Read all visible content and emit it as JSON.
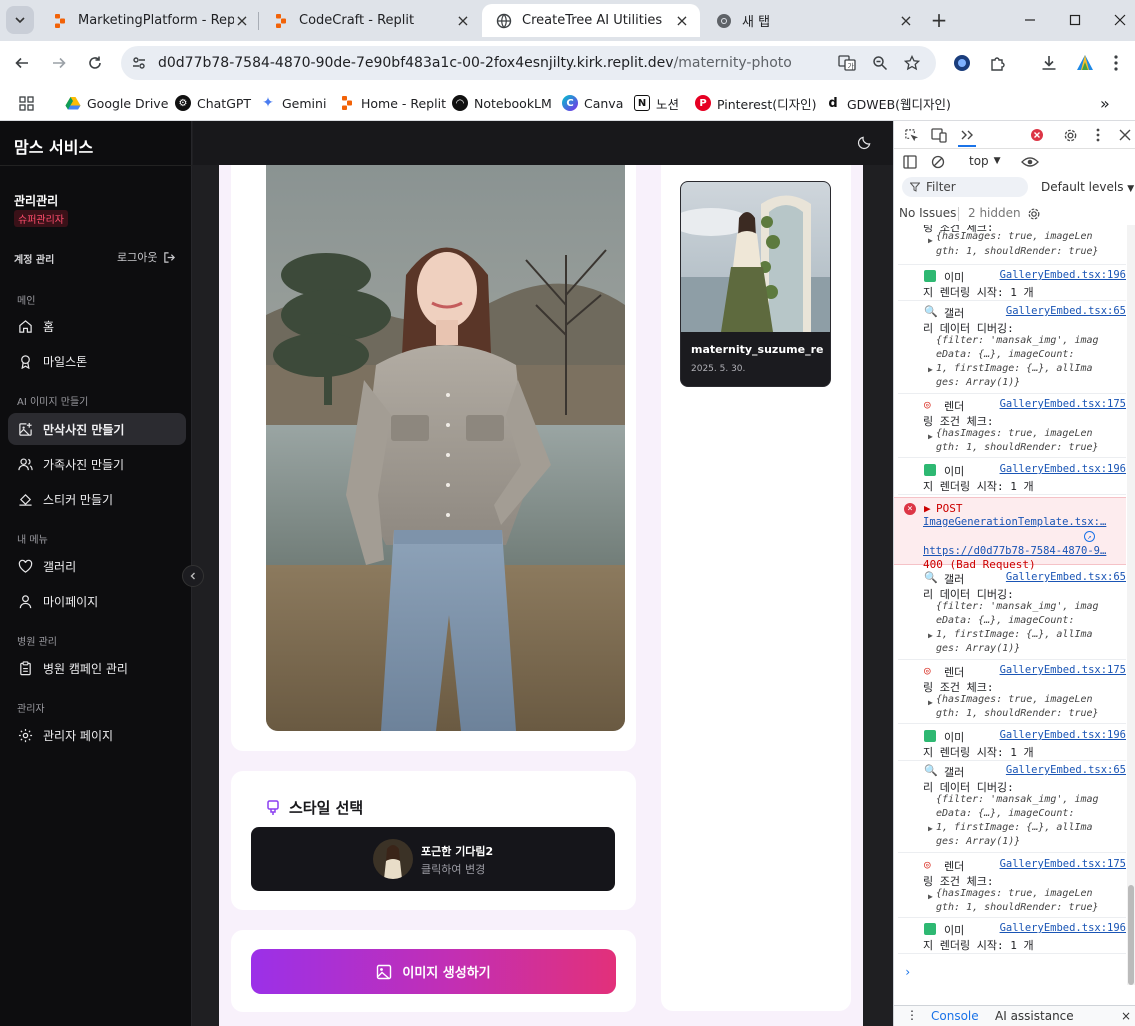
{
  "browser": {
    "tabs": [
      {
        "title": "MarketingPlatform - Replit",
        "icon": "replit-icon"
      },
      {
        "title": "CodeCraft - Replit",
        "icon": "replit-icon"
      },
      {
        "title": "CreateTree AI Utilities",
        "icon": "globe-icon",
        "active": true
      },
      {
        "title": "새 탭",
        "icon": "chrome-icon"
      }
    ],
    "url_host": "d0d77b78-7584-4870-90de-7e90bf483a1c-00-2fox4esnjilty.kirk.replit.dev",
    "url_path": "/maternity-photo",
    "bookmarks": [
      "Google Drive",
      "ChatGPT",
      "Gemini",
      "Home - Replit",
      "NotebookLM",
      "Canva",
      "노션",
      "Pinterest(디자인)",
      "GDWEB(웹디자인)"
    ]
  },
  "sidebar": {
    "brand": "맘스 서비스",
    "user_name": "관리관리",
    "user_role": "슈퍼관리자",
    "account_label": "계정 관리",
    "logout": "로그아웃",
    "sections": [
      {
        "label": "메인",
        "items": [
          "홈",
          "마일스톤"
        ]
      },
      {
        "label": "AI 이미지 만들기",
        "items": [
          "만삭사진 만들기",
          "가족사진 만들기",
          "스티커 만들기"
        ]
      },
      {
        "label": "내 메뉴",
        "items": [
          "갤러리",
          "마이페이지"
        ]
      },
      {
        "label": "병원 관리",
        "items": [
          "병원 캠페인 관리"
        ]
      },
      {
        "label": "관리자",
        "items": [
          "관리자 페이지"
        ]
      }
    ]
  },
  "main": {
    "style_title": "스타일 선택",
    "style_name": "포근한 기다림2",
    "style_hint": "클릭하여 변경",
    "generate_label": "이미지 생성하기",
    "gallery_item_name": "maternity_suzume_rea",
    "gallery_item_date": "2025. 5. 30."
  },
  "devtools": {
    "context": "top",
    "filter_placeholder": "Filter",
    "levels": "Default levels",
    "issues": "No Issues",
    "hidden": "2 hidden",
    "bottom_tabs": [
      "Console",
      "AI assistance"
    ],
    "error": {
      "method": "POST",
      "source": "ImageGenerationTemplate.tsx:…",
      "url": "https://d0d77b78-7584-4870-9…",
      "status": "400 (Bad Request)"
    }
  },
  "colors": {
    "accent_start": "#9b30e8",
    "accent_end": "#e2307a",
    "sidebar_bg": "#0d0d0f",
    "content_bg": "#f8f1fb"
  }
}
